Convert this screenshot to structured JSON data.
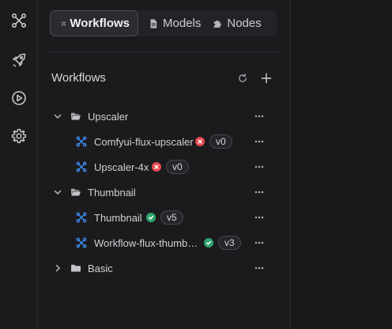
{
  "sidebar": {
    "items": [
      {
        "name": "workflows",
        "icon": "workflow-icon"
      },
      {
        "name": "deploy",
        "icon": "rocket-icon"
      },
      {
        "name": "run",
        "icon": "play-circle-icon"
      },
      {
        "name": "settings",
        "icon": "gear-icon"
      }
    ]
  },
  "tabs": [
    {
      "label": "Workflows",
      "icon": "workflow-icon",
      "active": true
    },
    {
      "label": "Models",
      "icon": "file-icon",
      "active": false
    },
    {
      "label": "Nodes",
      "icon": "puzzle-icon",
      "active": false
    }
  ],
  "panel": {
    "title": "Workflows",
    "refresh_icon": "refresh-icon",
    "add_icon": "plus-icon"
  },
  "tree": {
    "folders": [
      {
        "label": "Upscaler",
        "expanded": true,
        "items": [
          {
            "label": "Comfyui-flux-upscaler",
            "status": "error",
            "version": "v0"
          },
          {
            "label": "Upscaler-4x",
            "status": "error",
            "version": "v0"
          }
        ]
      },
      {
        "label": "Thumbnail",
        "expanded": true,
        "items": [
          {
            "label": "Thumbnail",
            "status": "ok",
            "version": "v5"
          },
          {
            "label": "Workflow-flux-thumb…",
            "status": "ok",
            "version": "v3"
          }
        ]
      },
      {
        "label": "Basic",
        "expanded": false,
        "items": []
      }
    ]
  },
  "colors": {
    "accent_blue": "#3d8df2",
    "error_red": "#e5484d",
    "success_green": "#30a46c",
    "background": "#1b1b1e"
  }
}
